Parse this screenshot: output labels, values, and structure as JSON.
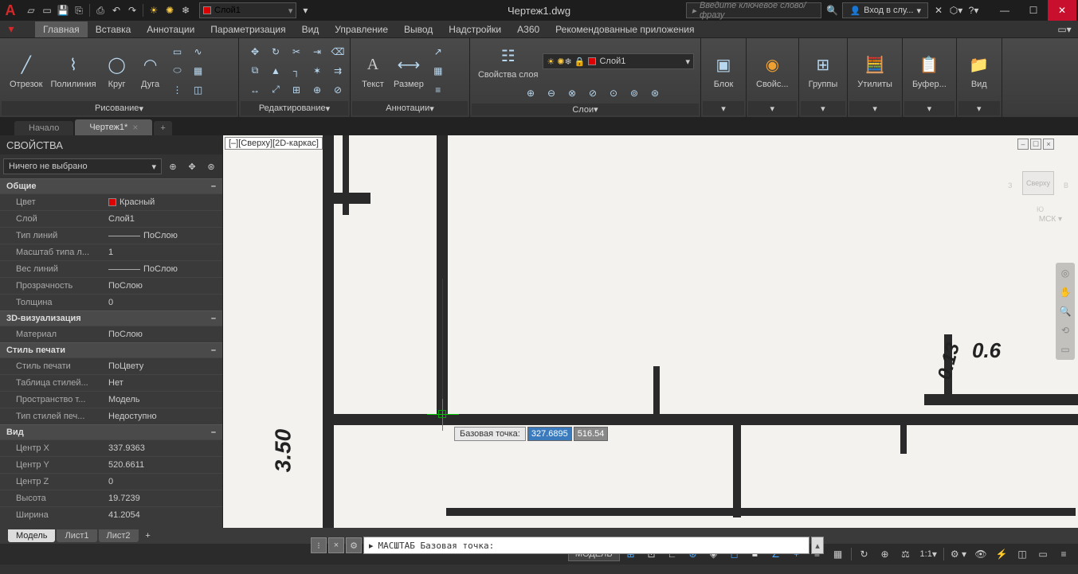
{
  "title": "Чертеж1.dwg",
  "qat_layer": "Слой1",
  "search_placeholder": "Введите ключевое слово/фразу",
  "signin": "Вход в слу...",
  "menu": {
    "tabs": [
      "Главная",
      "Вставка",
      "Аннотации",
      "Параметризация",
      "Вид",
      "Управление",
      "Вывод",
      "Надстройки",
      "A360",
      "Рекомендованные приложения"
    ],
    "active": 0
  },
  "ribbon": {
    "draw": {
      "title": "Рисование",
      "items": [
        "Отрезок",
        "Полилиния",
        "Круг",
        "Дуга"
      ]
    },
    "edit": {
      "title": "Редактирование"
    },
    "anno": {
      "title": "Аннотации",
      "text": "Текст",
      "dim": "Размер"
    },
    "layers": {
      "title": "Слои",
      "props": "Свойства слоя",
      "current": "Слой1"
    },
    "block": {
      "title": "",
      "block": "Блок",
      "props": "Свойс...",
      "groups": "Группы",
      "utils": "Утилиты",
      "buffer": "Буфер...",
      "view": "Вид"
    }
  },
  "file_tabs": {
    "start": "Начало",
    "active": "Чертеж1*"
  },
  "props_panel": {
    "title": "СВОЙСТВА",
    "selector": "Ничего не выбрано",
    "sections": {
      "general": {
        "title": "Общие",
        "rows": [
          {
            "k": "Цвет",
            "v": "Красный",
            "swatch": true
          },
          {
            "k": "Слой",
            "v": "Слой1"
          },
          {
            "k": "Тип линий",
            "v": "ПоСлою",
            "line": true
          },
          {
            "k": "Масштаб типа л...",
            "v": "1"
          },
          {
            "k": "Вес линий",
            "v": "ПоСлою",
            "line": true
          },
          {
            "k": "Прозрачность",
            "v": "ПоСлою"
          },
          {
            "k": "Толщина",
            "v": "0"
          }
        ]
      },
      "viz": {
        "title": "3D-визуализация",
        "rows": [
          {
            "k": "Материал",
            "v": "ПоСлою"
          }
        ]
      },
      "plot": {
        "title": "Стиль печати",
        "rows": [
          {
            "k": "Стиль печати",
            "v": "ПоЦвету"
          },
          {
            "k": "Таблица стилей...",
            "v": "Нет"
          },
          {
            "k": "Пространство т...",
            "v": "Модель"
          },
          {
            "k": "Тип стилей печ...",
            "v": "Недоступно"
          }
        ]
      },
      "view": {
        "title": "Вид",
        "rows": [
          {
            "k": "Центр X",
            "v": "337.9363"
          },
          {
            "k": "Центр Y",
            "v": "520.6611"
          },
          {
            "k": "Центр Z",
            "v": "0"
          },
          {
            "k": "Высота",
            "v": "19.7239"
          },
          {
            "k": "Ширина",
            "v": "41.2054"
          }
        ]
      }
    }
  },
  "viewport": {
    "label": "[–][Сверху][2D-каркас]",
    "cube": "Сверху",
    "cube_w": "З",
    "cube_e": "В",
    "cube_s": "Ю",
    "ucs": "МСК ▾",
    "tooltip_label": "Базовая точка:",
    "coord_x": "327.6895",
    "coord_y": "516.54",
    "dim1": "3.50",
    "dim2": "0.13",
    "dim3": "0.6"
  },
  "cmdline": "МАСШТАБ Базовая точка:",
  "bottom_tabs": [
    "Модель",
    "Лист1",
    "Лист2"
  ],
  "status": {
    "model": "МОДЕЛЬ",
    "scale": "1:1"
  }
}
